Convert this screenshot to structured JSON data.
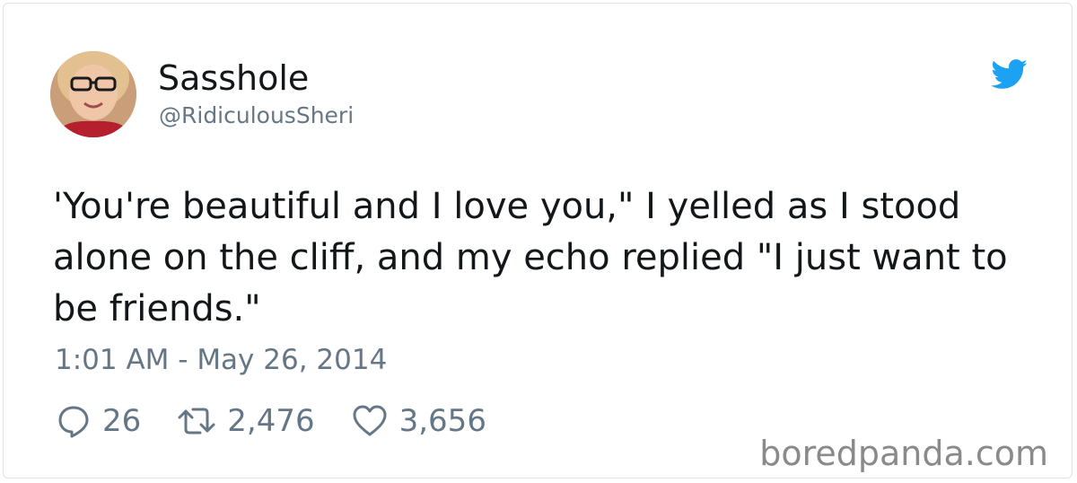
{
  "tweet": {
    "author_name": "Sasshole",
    "author_handle": "@RidiculousSheri",
    "text": "'You're beautiful and I love you,\" I yelled as I stood alone on the cliff, and my echo replied \"I just want to be friends.\"",
    "timestamp": "1:01 AM - May 26, 2014",
    "reply_count": "26",
    "retweet_count": "2,476",
    "like_count": "3,656"
  },
  "watermark": "boredpanda.com",
  "icons": {
    "brand": "twitter-bird-icon",
    "reply": "reply-icon",
    "retweet": "retweet-icon",
    "like": "heart-icon"
  },
  "colors": {
    "twitter_blue": "#1da1f2",
    "text": "#14171a",
    "secondary_text": "#657786",
    "watermark": "#8a8a8a"
  }
}
